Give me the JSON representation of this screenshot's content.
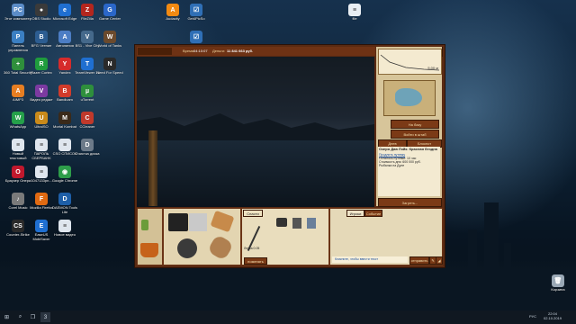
{
  "desktop": {
    "icons": [
      {
        "label": "Этот компьютер",
        "color": "#5b8cc7",
        "glyph": "PC"
      },
      {
        "label": "OBS Studio",
        "color": "#3a3a3a",
        "glyph": "●"
      },
      {
        "label": "Microsoft Edge",
        "color": "#1f6fd1",
        "glyph": "e"
      },
      {
        "label": "FileZilla",
        "color": "#b3261e",
        "glyph": "Z"
      },
      {
        "label": "Game Center",
        "color": "#2b67c9",
        "glyph": "G"
      },
      {
        "label": "Audacity",
        "color": "#f28a12",
        "glyph": "A"
      },
      {
        "label": "Get4PicSo",
        "color": "#4f73b8",
        "glyph": "G"
      },
      {
        "label": "Панель управления",
        "color": "#3b7fc2",
        "glyph": "P"
      },
      {
        "label": "BFG Чтение",
        "color": "#2d5d91",
        "glyph": "B"
      },
      {
        "label": "Автолиния",
        "color": "#4c7dc4",
        "glyph": "A"
      },
      {
        "label": "BS1 - Vive City",
        "color": "#45698b",
        "glyph": "V"
      },
      {
        "label": "World of Tanks",
        "color": "#6b4a2d",
        "glyph": "W"
      },
      {
        "label": "360 Total Security",
        "color": "#2f8f3c",
        "glyph": "+"
      },
      {
        "label": "Razer Cortex",
        "color": "#1f9c3d",
        "glyph": "R"
      },
      {
        "label": "Yandex",
        "color": "#d62b2b",
        "glyph": "Y"
      },
      {
        "label": "TeamViewer 14",
        "color": "#1f6fd1",
        "glyph": "T"
      },
      {
        "label": "Need For Speed",
        "color": "#2a2a2a",
        "glyph": "N"
      },
      {
        "label": "AIMP3",
        "color": "#e67e22",
        "glyph": "A"
      },
      {
        "label": "Видео редакт",
        "color": "#7c3aa1",
        "glyph": "V"
      },
      {
        "label": "Bandicam",
        "color": "#d13b2b",
        "glyph": "B"
      },
      {
        "label": "uTorrent",
        "color": "#2e8f3c",
        "glyph": "µ"
      },
      {
        "label": "WhatsApp",
        "color": "#25a04a",
        "glyph": "W"
      },
      {
        "label": "UltraISO",
        "color": "#c98a1a",
        "glyph": "U"
      },
      {
        "label": "Mortal Kombat",
        "color": "#3a2a1a",
        "glyph": "M"
      },
      {
        "label": "CCleaner",
        "color": "#c0392b",
        "glyph": "C"
      },
      {
        "label": "Новый текстовый",
        "color": "#dfe6ee",
        "glyph": "≡"
      },
      {
        "label": "ПАРОЛЬ СБЕРБАНК",
        "color": "#dfe6ee",
        "glyph": "≡"
      },
      {
        "label": "CSO СПИСОК",
        "color": "#dfe6ee",
        "glyph": "≡"
      },
      {
        "label": "Очистка диска",
        "color": "#6c7a89",
        "glyph": "D"
      },
      {
        "label": "Браузер Опера",
        "color": "#c0182d",
        "glyph": "O"
      },
      {
        "label": "1047133pn...",
        "color": "#dfe6ee",
        "glyph": "≡"
      },
      {
        "label": "Google Chrome",
        "color": "#2e9d4a",
        "glyph": "◉"
      },
      {
        "label": "Corel Music",
        "color": "#7a7a7a",
        "glyph": "♪"
      },
      {
        "label": "Mozilla Firefox",
        "color": "#e06a12",
        "glyph": "F"
      },
      {
        "label": "DAEMON Tools Lite",
        "color": "#1e5fa8",
        "glyph": "D"
      },
      {
        "label": "Counter-Strike",
        "color": "#2a2a2a",
        "glyph": "CS"
      },
      {
        "label": "EaseUS MobiSaver",
        "color": "#1f6fd1",
        "glyph": "E"
      },
      {
        "label": "Новое видео",
        "color": "#dfe6ee",
        "glyph": "≡"
      }
    ],
    "recycle_bin": "Корзина"
  },
  "game": {
    "topbar": {
      "money_label": "Время:",
      "time_value": "04:10:07",
      "balance_label": "Деньги:",
      "balance_value": "11 841 663 руб.",
      "online_services": "Онлайн сервисы",
      "help": "?",
      "menu": "Меню"
    },
    "right": {
      "distance": "5,00 м",
      "base_button": "На базу",
      "headquarters_button": "Войти в штаб",
      "tab_lake": "Днев",
      "tab_contacts": "Блокнот",
      "lake_title": "Озеро Дав Лэйк. Красная бездна",
      "extend_permit": "Продлить путевку",
      "permit_text": "Осталось путевки: 10 час",
      "cost_text": "Стоимость дня: 600 000 руб.",
      "fish_text": "Рыбалка на Дуле",
      "goals_button": "Загреть..."
    },
    "chat": {
      "tab1": "Игроки",
      "tab2": "Событие",
      "placeholder": "Кликните, чтобы ввести текст",
      "send": "отправить"
    },
    "tackle": {
      "title": "Снасти",
      "line": "Леска 0.05",
      "rod": "Удочка",
      "change": "поменять"
    }
  },
  "taskbar": {
    "time": "22:04",
    "date": "02.10.2019",
    "lang": "РУС"
  }
}
